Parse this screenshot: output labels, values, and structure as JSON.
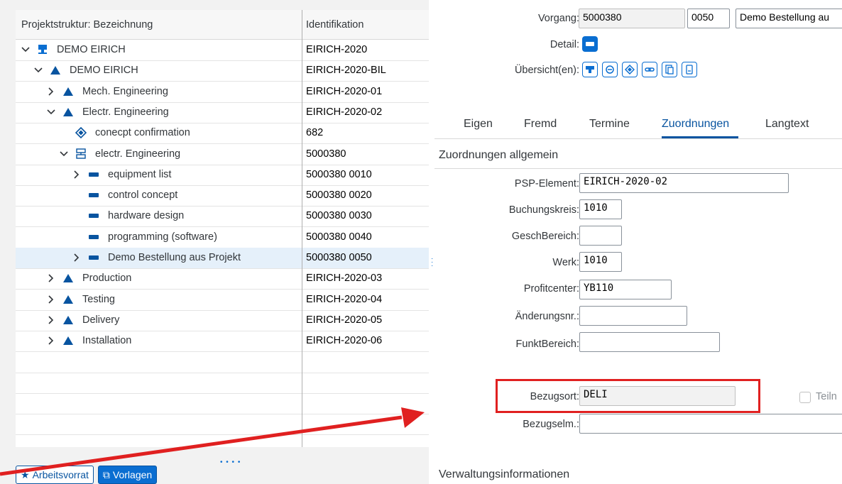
{
  "tree": {
    "columns": {
      "name": "Projektstruktur: Bezeichnung",
      "id": "Identifikation"
    },
    "rows": [
      {
        "label": "DEMO EIRICH",
        "id": "EIRICH-2020",
        "chev": "down",
        "icon": "project-icon",
        "level": 0
      },
      {
        "label": "DEMO EIRICH",
        "id": "EIRICH-2020-BIL",
        "chev": "down",
        "icon": "wbs-element-icon",
        "level": 1
      },
      {
        "label": "Mech. Engineering",
        "id": "EIRICH-2020-01",
        "chev": "right",
        "icon": "wbs-element-icon",
        "level": 2
      },
      {
        "label": "Electr. Engineering",
        "id": "EIRICH-2020-02",
        "chev": "down",
        "icon": "wbs-element-icon",
        "level": 2
      },
      {
        "label": "conecpt confirmation",
        "id": "682",
        "chev": "none",
        "icon": "milestone-icon",
        "level": 3
      },
      {
        "label": "electr. Engineering",
        "id": "5000380",
        "chev": "down",
        "icon": "network-icon",
        "level": 3
      },
      {
        "label": "equipment list",
        "id": "5000380 0010",
        "chev": "right",
        "icon": "activity-icon",
        "level": 4
      },
      {
        "label": "control concept",
        "id": "5000380 0020",
        "chev": "none",
        "icon": "activity-icon",
        "level": 4
      },
      {
        "label": "hardware design",
        "id": "5000380 0030",
        "chev": "none",
        "icon": "activity-icon",
        "level": 4
      },
      {
        "label": "programming (software)",
        "id": "5000380 0040",
        "chev": "none",
        "icon": "activity-icon",
        "level": 4
      },
      {
        "label": "Demo Bestellung aus Projekt",
        "id": "5000380 0050",
        "chev": "right",
        "icon": "activity-icon",
        "level": 4,
        "selected": true
      },
      {
        "label": "Production",
        "id": "EIRICH-2020-03",
        "chev": "right",
        "icon": "wbs-element-icon",
        "level": 2
      },
      {
        "label": "Testing",
        "id": "EIRICH-2020-04",
        "chev": "right",
        "icon": "wbs-element-icon",
        "level": 2
      },
      {
        "label": "Delivery",
        "id": "EIRICH-2020-05",
        "chev": "right",
        "icon": "wbs-element-icon",
        "level": 2
      },
      {
        "label": "Installation",
        "id": "EIRICH-2020-06",
        "chev": "right",
        "icon": "wbs-element-icon",
        "level": 2
      }
    ]
  },
  "toolbar": {
    "worklist": "Arbeitsvorrat",
    "templates": "Vorlagen"
  },
  "header": {
    "vorgang_label": "Vorgang:",
    "vorgang_value": "5000380",
    "vorgang_op": "0050",
    "vorgang_desc": "Demo Bestellung au",
    "detail_label": "Detail:",
    "overview_label": "Übersicht(en):"
  },
  "tabs": [
    "Eigen",
    "Fremd",
    "Termine",
    "Zuordnungen",
    "Langtext"
  ],
  "active_tab": "Zuordnungen",
  "section": {
    "title": "Zuordnungen allgemein",
    "fields": {
      "psp_label": "PSP-Element:",
      "psp_value": "EIRICH-2020-02",
      "bukrs_label": "Buchungskreis:",
      "bukrs_value": "1010",
      "gsber_label": "GeschBereich:",
      "gsber_value": "",
      "werk_label": "Werk:",
      "werk_value": "1010",
      "prctr_label": "Profitcenter:",
      "prctr_value": "YB110",
      "aenr_label": "Änderungsnr.:",
      "aenr_value": "",
      "fkber_label": "FunktBereich:",
      "fkber_value": "",
      "bezugsort_label": "Bezugsort:",
      "bezugsort_value": "DELI",
      "bezugselm_label": "Bezugselm.:",
      "bezugselm_value": "",
      "teiln_label": "Teiln"
    }
  },
  "section2_title": "Verwaltungsinformationen",
  "colors": {
    "accent": "#0a6ed1",
    "highlight": "#e02020",
    "selection": "#e5f0fa"
  }
}
